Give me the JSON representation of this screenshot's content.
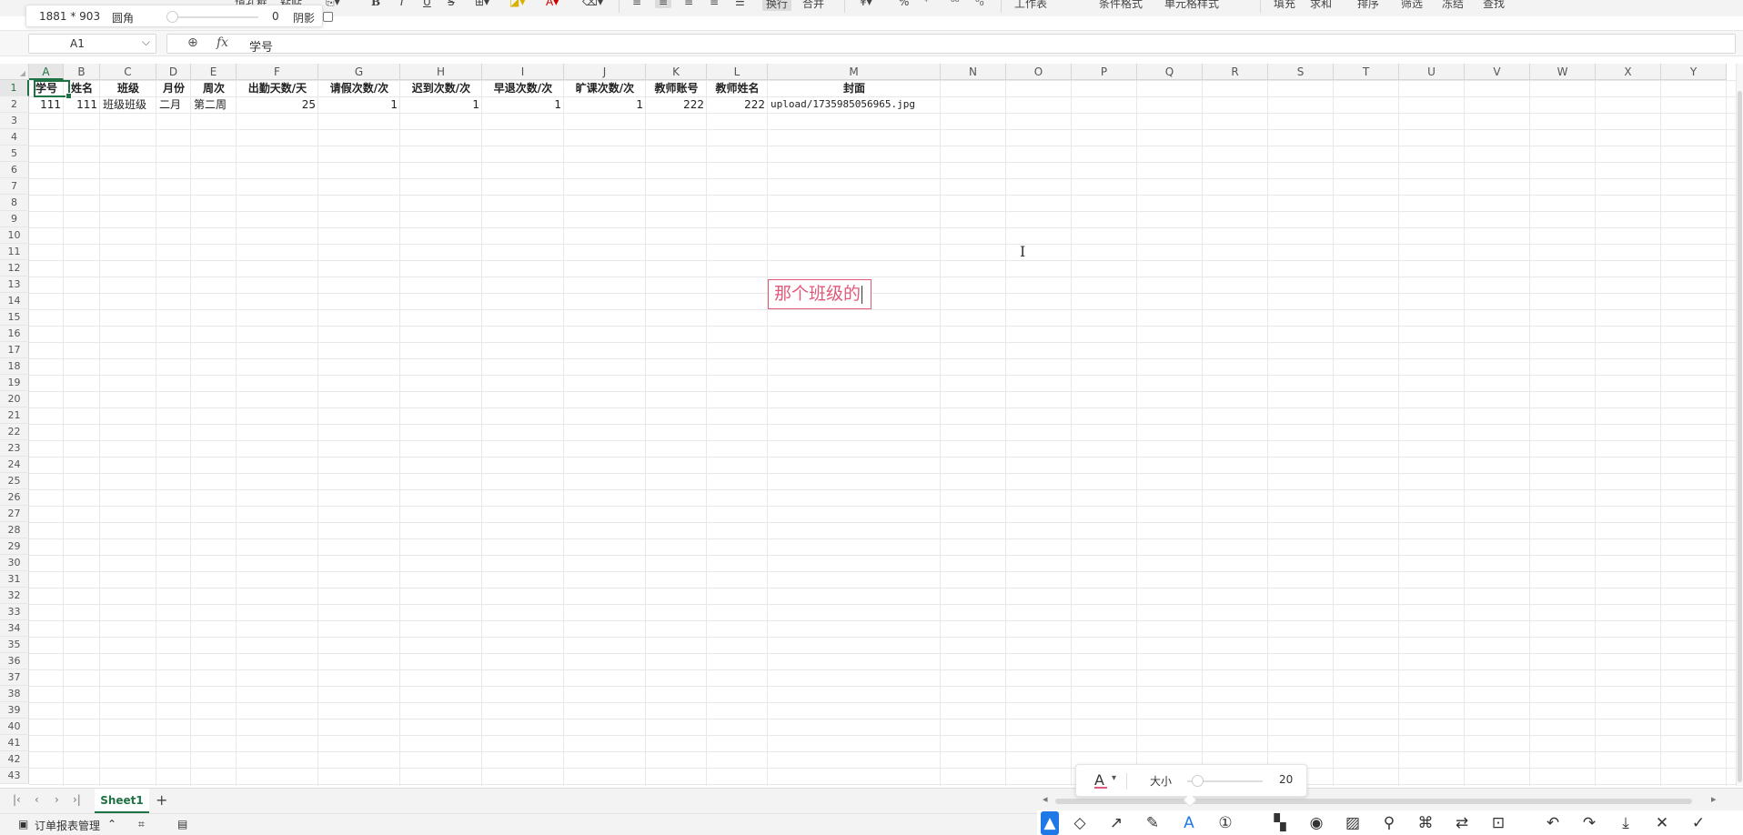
{
  "toolbar": {
    "items": [
      "填孔框",
      "粘贴",
      "B",
      "I",
      "U",
      "S",
      "换行",
      "合并",
      "工作表",
      "条件格式",
      "单元格样式",
      "填充",
      "求和",
      "排序",
      "筛选",
      "冻结",
      "查找"
    ]
  },
  "snapshot": {
    "dimensions": "1881 * 903",
    "radius_label": "圆角",
    "radius_value": "0",
    "shadow_label": "阴影"
  },
  "formula_bar": {
    "cell_ref": "A1",
    "fx_label": "fx",
    "value": "学号"
  },
  "columns": [
    "A",
    "B",
    "C",
    "D",
    "E",
    "F",
    "G",
    "H",
    "I",
    "J",
    "K",
    "L",
    "M",
    "N",
    "O",
    "P",
    "Q",
    "R",
    "S",
    "T",
    "U",
    "V",
    "W",
    "X",
    "Y"
  ],
  "rows_count": 43,
  "sheet": {
    "header_row": [
      "学号",
      "姓名",
      "班级",
      "月份",
      "周次",
      "出勤天数/天",
      "请假次数/次",
      "迟到次数/次",
      "早退次数/次",
      "旷课次数/次",
      "教师账号",
      "教师姓名",
      "封面"
    ],
    "data_row": [
      "111",
      "111",
      "班级班级",
      "二月",
      "第二周",
      "25",
      "1",
      "1",
      "1",
      "1",
      "222",
      "222",
      "upload/1735985056965.jpg"
    ]
  },
  "annotation": {
    "text": "那个班级的"
  },
  "sheet_tabs": {
    "active": "Sheet1",
    "add": "+"
  },
  "status_bar": {
    "app_label": "订单报表管理"
  },
  "size_panel": {
    "label": "大小",
    "value": "20",
    "font_icon": "A"
  },
  "colors": {
    "accent_green": "#1f7244",
    "annotation_pink": "#e05a7a",
    "tool_blue": "#1e78e6"
  }
}
